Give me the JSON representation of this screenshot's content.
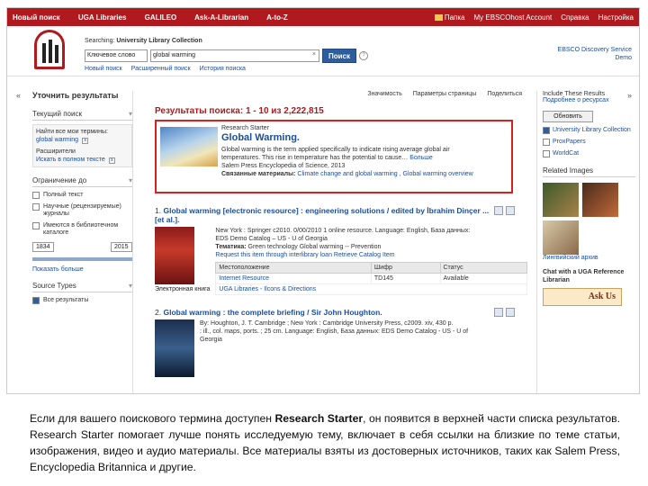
{
  "topnav": {
    "items": [
      "Новый поиск",
      "UGA Libraries",
      "GALILEO",
      "Ask-A-Librarian",
      "A-to-Z"
    ],
    "right": [
      "Папка",
      "My EBSCOhost Account",
      "Справка",
      "Настройка"
    ]
  },
  "search": {
    "label_prefix": "Searching:",
    "label_collection": "University Library Collection",
    "select_value": "Ключевое слово",
    "query": "global warming",
    "button": "Поиск",
    "links": [
      "Новый поиск",
      "Расширенный поиск",
      "История поиска"
    ],
    "eds_line1": "EBSCO Discovery Service",
    "eds_line2": "Demo"
  },
  "left": {
    "refine": "Уточнить результаты",
    "current_search": "Текущий поиск",
    "find_all_terms": "Найти все мои термины:",
    "term": "global warming",
    "expanders": "Расширители",
    "expander_item": "Искать в полном тексте",
    "limit_to": "Ограничение до",
    "limits": [
      "Полный текст",
      "Научные (рецензируемые) журналы",
      "Имеются в библиотечном каталоге"
    ],
    "date_from": "1834",
    "date_to": "2015",
    "show_more": "Показать больше",
    "source_types": "Source Types",
    "source_all": "Все результаты"
  },
  "center": {
    "toolbar": [
      "Значимость",
      "Параметры страницы",
      "Поделиться"
    ],
    "results_title": "Результаты поиска: 1 - 10 из 2,222,815",
    "starter": {
      "kicker": "Research Starter",
      "title": "Global Warming.",
      "desc1": "Global warming is the term applied specifically to indicate rising average global air",
      "desc2": "temperatures. This rise in temperature has the potential to cause…",
      "more": "Больше",
      "source": "Salem Press Encyclopedia of Science, 2013",
      "related_label": "Связанные материалы:",
      "related_links": "Climate change and global warming , Global warming overview"
    },
    "result1": {
      "num": "1.",
      "title": "Global warming [electronic resource] : engineering solutions / edited by İbrahim Dinçer ... [et al.].",
      "line1": "New York : Springer c2010. 0/00/2010 1 online resource. Language: English, База данных:",
      "line2": "EDS Demo Catalog – US - U of Georgia",
      "subjects_label": "Тематика:",
      "subjects": "Green technology Global warming -- Prevention",
      "links": "Request this item through interlibrary loan   Retrieve Catalog Item",
      "col_location": "Местоположение",
      "col_call": "Шифр",
      "col_status": "Статус",
      "row1_loc": "Internet Resource",
      "row1_call": "TD145",
      "row1_status": "Available",
      "row2_loc": "UGA Libraries - Ilcons & Directions",
      "format": "Электронная книга"
    },
    "result2": {
      "num": "2.",
      "title": "Global warming : the complete briefing / Sir John Houghton.",
      "line1": "By: Houghton, J. T. Cambridge ; New York : Cambridge University Press, c2009. xiv, 430 p.",
      "line2": ": ill., col. maps, ports. ; 25 cm. Language: English, База данных: EDS Demo Catalog - US - U of",
      "line3": "Georgia"
    }
  },
  "right": {
    "include_related": "Include These Results",
    "details": "Подробнее о ресурсах",
    "update": "Обновить",
    "dbs": [
      "University Library Collection",
      "ProxPapers",
      "WorldCat"
    ],
    "related_images": "Related Images",
    "image_caption": "Лингвийский архив",
    "chat": "Chat with a UGA Reference Librarian",
    "ask_us": "Ask Us"
  },
  "caption": {
    "part1": "Если для вашего поискового термина доступен",
    "bold": "Research Starter",
    "part2": ", он появится в верхней части списка результатов. Research Starter помогает лучше понять исследуемую тему, включает в себя ссылки на близкие по теме статьи, изображения, видео и аудио материалы. Все материалы взяты из достоверных источников, таких как Salem Press, Encyclopedia Britannica и другие."
  },
  "colors": {
    "brand_red": "#b0191d",
    "link_blue": "#1a4ea0",
    "highlight_border": "#d62121"
  }
}
